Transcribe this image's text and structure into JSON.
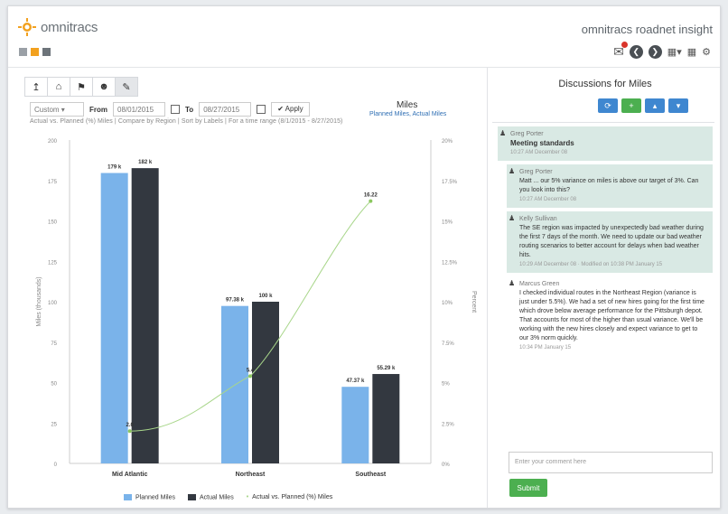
{
  "header": {
    "logo_text": "omnitracs",
    "app_title": "omnitracs roadnet insight"
  },
  "toolbar": {
    "buttons": [
      "upload-icon",
      "home-icon",
      "flag-icon",
      "user-icon",
      "pin-icon"
    ]
  },
  "filters": {
    "range_select": "Custom",
    "from_label": "From",
    "from_value": "08/01/2015",
    "to_label": "To",
    "to_value": "08/27/2015",
    "apply_label": "Apply"
  },
  "chart_header": {
    "title": "Miles",
    "series_summary": "Planned Miles, Actual Miles",
    "subtitle": "Actual vs. Planned (%) Miles | Compare by Region | Sort by Labels | For a time range (8/1/2015 - 8/27/2015)"
  },
  "chart_data": {
    "type": "bar",
    "categories": [
      "Mid Atlantic",
      "Northeast",
      "Southeast"
    ],
    "series": [
      {
        "name": "Planned Miles",
        "values": [
          179.6,
          97.38,
          47.37
        ],
        "labels": [
          "179 k",
          "97.38 k",
          "47.37 k"
        ],
        "color": "#7ab3ea"
      },
      {
        "name": "Actual Miles",
        "values": [
          182.6,
          100.0,
          55.29
        ],
        "labels": [
          "182 k",
          "100 k",
          "55.29 k"
        ],
        "color": "#333840"
      }
    ],
    "line_series": {
      "name": "Actual vs. Planned (%) Miles",
      "values": [
        2.0,
        5.4,
        16.22
      ],
      "labels": [
        "2.0",
        "5.4",
        "16.22"
      ],
      "color": "#a8d68a"
    },
    "ylabel": "Miles (thousands)",
    "y2label": "Percent",
    "ylim": [
      0,
      200
    ],
    "y2lim": [
      0,
      20
    ],
    "yticks": [
      "0",
      "25",
      "50",
      "75",
      "100",
      "125",
      "150",
      "175",
      "200"
    ],
    "y2ticks": [
      "0%",
      "2.5%",
      "5%",
      "7.5%",
      "10%",
      "12.5%",
      "15%",
      "17.5%",
      "20%"
    ],
    "grid": false,
    "legend": "bottom"
  },
  "legend": {
    "planned": "Planned Miles",
    "actual": "Actual Miles",
    "pct": "Actual vs. Planned (%) Miles"
  },
  "discussions": {
    "title": "Discussions for Miles",
    "comment_placeholder": "Enter your comment here",
    "submit_label": "Submit",
    "messages": [
      {
        "author": "Greg Porter",
        "title": "Meeting standards",
        "body": "",
        "time": "10:27 AM December 08",
        "highlight": true,
        "nested": false
      },
      {
        "author": "Greg Porter",
        "title": "",
        "body": "Matt ... our 5% variance on miles is above our target of 3%. Can you look into this?",
        "time": "10:27 AM December 08",
        "highlight": true,
        "nested": true
      },
      {
        "author": "Kelly Sullivan",
        "title": "",
        "body": "The SE region was impacted by unexpectedly bad weather during the first 7 days of the month. We need to update our bad weather routing scenarios to better account for delays when bad weather hits.",
        "time": "10:29 AM December 08 · Modified on 10:38 PM January 15",
        "highlight": true,
        "nested": true
      },
      {
        "author": "Marcus Green",
        "title": "",
        "body": "I checked individual routes in the Northeast Region (variance is just under 5.5%). We had a set of new hires going for the first time which drove below average performance for the Pittsburgh depot. That accounts for most of the higher than usual variance. We'll be working with the new hires closely and expect variance to get to our 3% norm quickly.",
        "time": "10:34 PM January 15",
        "highlight": false,
        "nested": true
      }
    ]
  }
}
